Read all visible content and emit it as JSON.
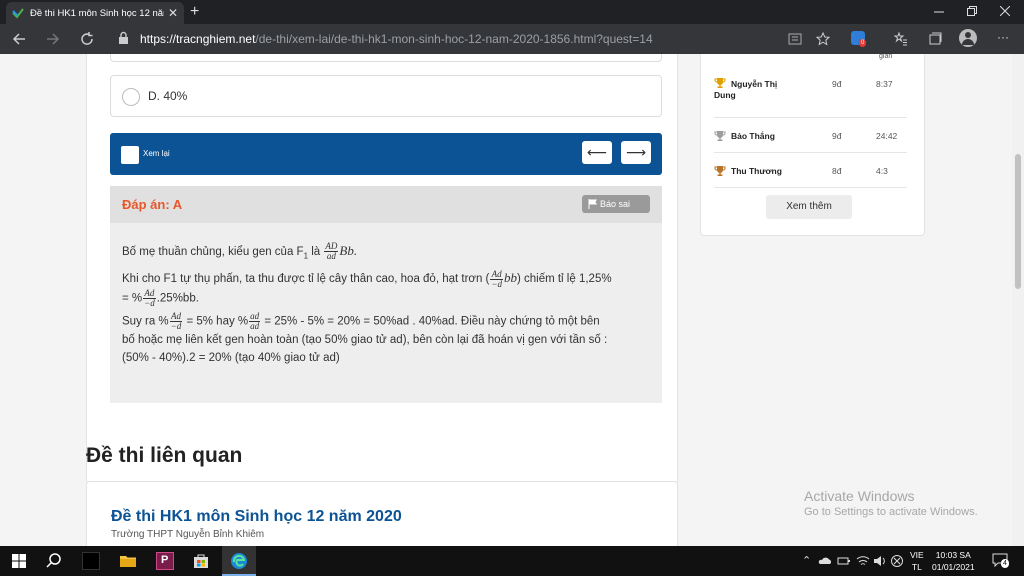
{
  "browser": {
    "tab_title": "Đề thi HK1 môn Sinh học 12 năm",
    "tab_close": "✕",
    "new_tab": "+",
    "url_scheme": "https://",
    "url_host": "tracnghiem.net",
    "url_path": "/de-thi/xem-lai/de-thi-hk1-mon-sinh-hoc-12-nam-2020-1856.html?quest=14",
    "extension_badge": "0",
    "menu": "···"
  },
  "question": {
    "option_d": "D. 40%",
    "review_label": "Xem lại",
    "prev_arrow": "⟵",
    "next_arrow": "⟶"
  },
  "answer": {
    "label": "Đáp án: A",
    "report_label": "Báo sai",
    "line1_prefix": "Bố mẹ thuần chủng, kiểu gen của F",
    "line1_sub": "1",
    "line1_mid": " là ",
    "line1_frac_num": "AD",
    "line1_frac_den": "ad",
    "line1_tail": "Bb.",
    "line2_prefix": "Khi cho F1 tự thụ phấn, ta thu được tỉ lệ cây thân cao, hoa đỏ, hạt trơn (",
    "line2_frac_num": "Ad",
    "line2_frac_den": "−d",
    "line2_mid": "bb",
    "line2_tail": ") chiếm tỉ lệ 1,25%",
    "line3_prefix": "= %",
    "line3_frac_num": "Ad",
    "line3_frac_den": "−d",
    "line3_tail": ".25%bb.",
    "line4_prefix": "Suy ra %",
    "line4_frac1_num": "Ad",
    "line4_frac1_den": "−d",
    "line4_mid": " = 5% hay %",
    "line4_frac2_num": "ad",
    "line4_frac2_den": "ad",
    "line4_tail": " = 25% - 5% = 20% = 50%ad . 40%ad. Điều này chứng tỏ một bên",
    "line5": "bố hoặc mẹ liên kết gen hoàn toàn (tạo 50% giao tử ad), bên còn lại đã hoán vị gen với tần số :",
    "line6": "(50% - 40%).2 = 20% (tạo 40% giao tử ad)"
  },
  "related": {
    "heading": "Đề thi liên quan",
    "title": "Đề thi HK1 môn Sinh học 12 năm 2020",
    "school": "Trường THPT Nguyễn Bỉnh Khiêm"
  },
  "leaderboard": {
    "header_time": "gian",
    "rows": [
      {
        "name": "Nguyễn Thị Dung",
        "score": "9đ",
        "time": "8:37"
      },
      {
        "name": "Bảo Thắng",
        "score": "9đ",
        "time": "24:42"
      },
      {
        "name": "Thu Thương",
        "score": "8đ",
        "time": "4:3"
      }
    ],
    "more_label": "Xem thêm"
  },
  "watermark": {
    "line1": "Activate Windows",
    "line2": "Go to Settings to activate Windows."
  },
  "taskbar": {
    "lang_top": "VIE",
    "lang_bottom": "TL",
    "time": "10:03 SA",
    "date": "01/01/2021",
    "notif_count": "4"
  },
  "colors": {
    "brand_blue": "#0b5394",
    "answer_orange": "#e8572a"
  }
}
